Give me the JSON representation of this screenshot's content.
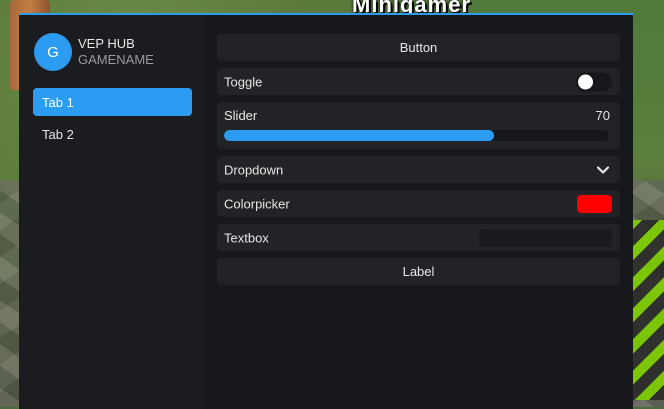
{
  "game": {
    "overlay_text": "Minigamer"
  },
  "hub": {
    "avatar_initial": "G",
    "title": "VEP HUB",
    "subtitle": "GAMENAME",
    "accent_color": "#2b9cf2"
  },
  "tabs": [
    {
      "label": "Tab 1",
      "active": true
    },
    {
      "label": "Tab 2",
      "active": false
    }
  ],
  "controls": {
    "button_label": "Button",
    "toggle": {
      "label": "Toggle",
      "on": false
    },
    "slider": {
      "label": "Slider",
      "value": "70",
      "fill_fraction": 0.7
    },
    "dropdown": {
      "label": "Dropdown",
      "icon": "chevron-down-icon"
    },
    "colorpicker": {
      "label": "Colorpicker",
      "color": "#ff0000"
    },
    "textbox": {
      "label": "Textbox",
      "value": "",
      "placeholder": ""
    },
    "label_text": "Label"
  }
}
